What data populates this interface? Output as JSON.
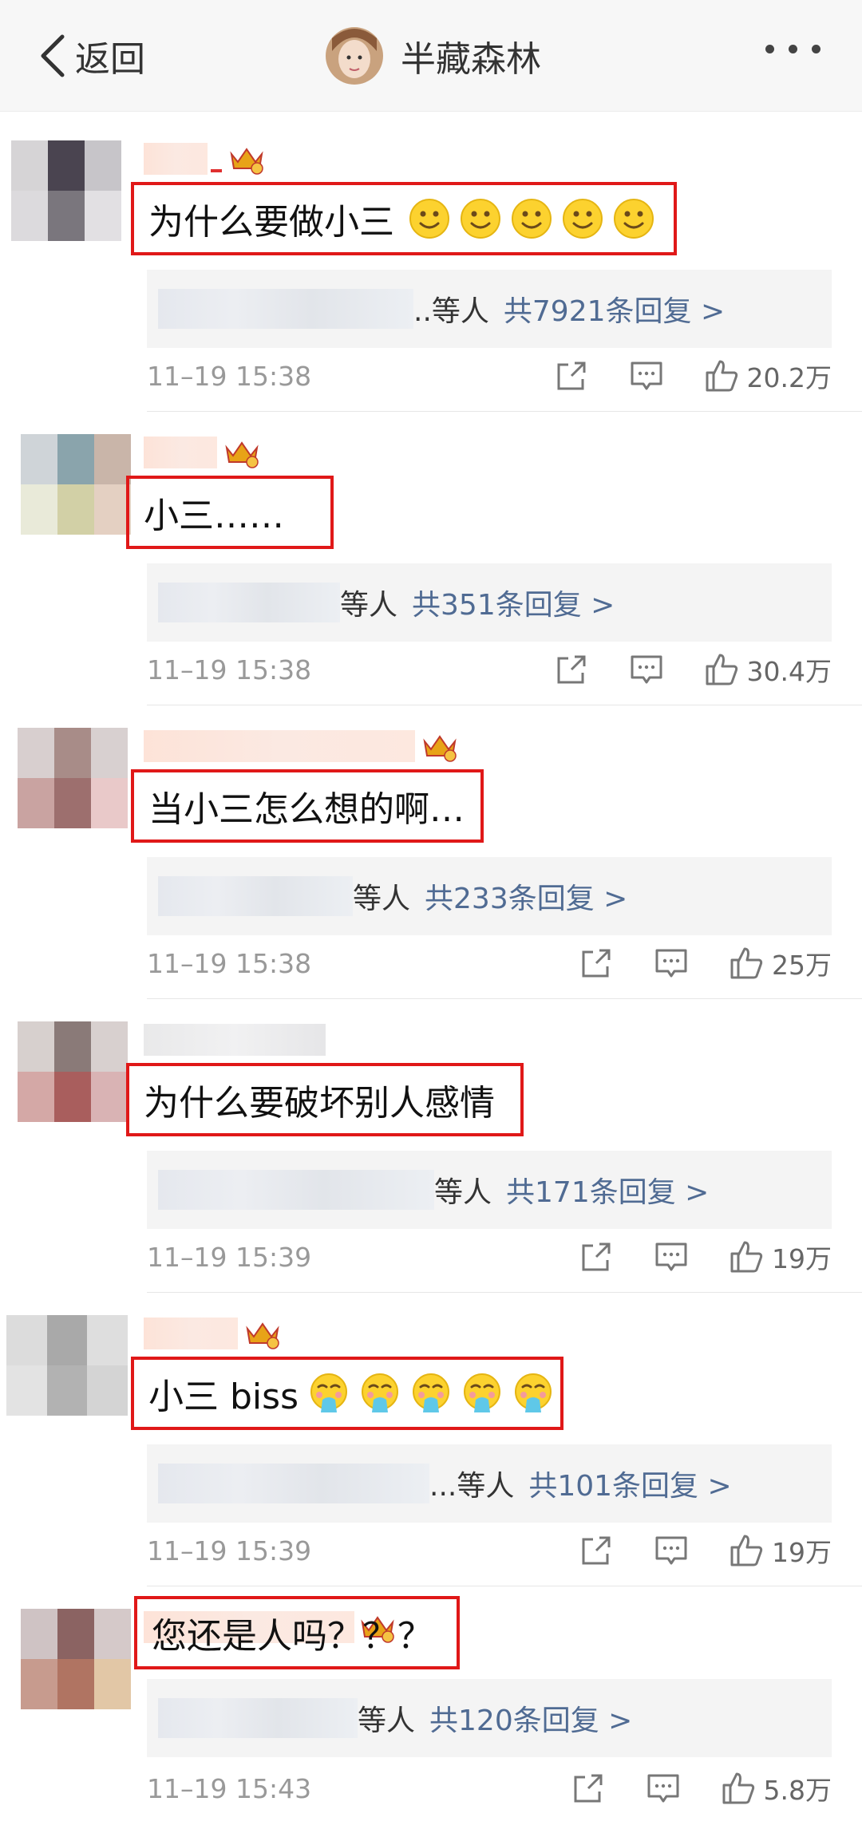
{
  "header": {
    "back_label": "返回",
    "title": "半藏森林"
  },
  "comments": [
    {
      "text": "为什么要做小三",
      "emoji_count": 5,
      "emoji": "smile-icon",
      "reply_suffix": "..等人",
      "reply_link": "共7921条回复 >",
      "time": "11–19 15:38",
      "likes": "20.2万"
    },
    {
      "text": "小三……",
      "emoji_count": 0,
      "reply_suffix": "等人",
      "reply_link": "共351条回复 >",
      "time": "11–19 15:38",
      "likes": "30.4万"
    },
    {
      "text": "当小三怎么想的啊…",
      "emoji_count": 0,
      "reply_suffix": "等人",
      "reply_link": "共233条回复 >",
      "time": "11–19 15:38",
      "likes": "25万"
    },
    {
      "text": "为什么要破坏别人感情",
      "emoji_count": 0,
      "reply_suffix": "等人",
      "reply_link": "共171条回复 >",
      "time": "11–19 15:39",
      "likes": "19万"
    },
    {
      "text": "小三 biss",
      "emoji_count": 5,
      "emoji": "vomit-face-icon",
      "reply_suffix": "...等人",
      "reply_link": "共101条回复 >",
      "time": "11–19 15:39",
      "likes": "19万"
    },
    {
      "text": "您还是人吗？？？",
      "emoji_count": 0,
      "reply_suffix": "等人",
      "reply_link": "共120条回复 >",
      "time": "11–19 15:43",
      "likes": "5.8万"
    }
  ],
  "colors": {
    "highlight_border": "#e01818",
    "link": "#506b93",
    "meta": "#999999"
  }
}
